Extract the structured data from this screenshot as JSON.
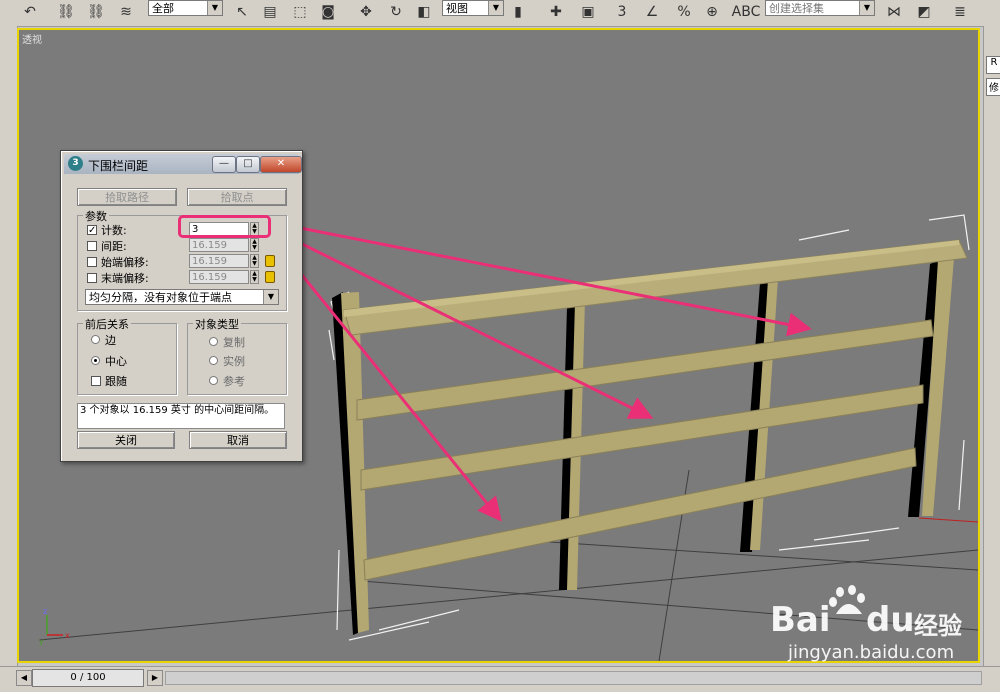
{
  "toolbar": {
    "selection_filter": "全部",
    "ref_coord": "视图",
    "named_selection": "创建选择集",
    "snap_label": "3"
  },
  "viewport": {
    "label": "透视"
  },
  "right_panel": {
    "items": [
      "R",
      "修"
    ]
  },
  "dialog": {
    "title": "下围栏间距",
    "btn_pick_path": "拾取路径",
    "btn_pick_points": "拾取点",
    "params_label": "参数",
    "count_label": "计数:",
    "count_value": "3",
    "spacing_label": "间距:",
    "spacing_value": "16.159",
    "start_offset_label": "始端偏移:",
    "start_offset_value": "16.159",
    "end_offset_label": "末端偏移:",
    "end_offset_value": "16.159",
    "distribution": "均匀分隔，没有对象位于端点",
    "context_label": "前后关系",
    "ctx_edge": "边",
    "ctx_center": "中心",
    "ctx_follow": "跟随",
    "type_label": "对象类型",
    "type_copy": "复制",
    "type_instance": "实例",
    "type_reference": "参考",
    "status": "3 个对象以 16.159 英寸 的中心间距间隔。",
    "close": "关闭",
    "cancel": "取消"
  },
  "timeline": {
    "frame": "0 / 100"
  },
  "watermark": {
    "brand": "Bai",
    "brand_du": "du",
    "cn": "经验",
    "url": "jingyan.baidu.com"
  }
}
